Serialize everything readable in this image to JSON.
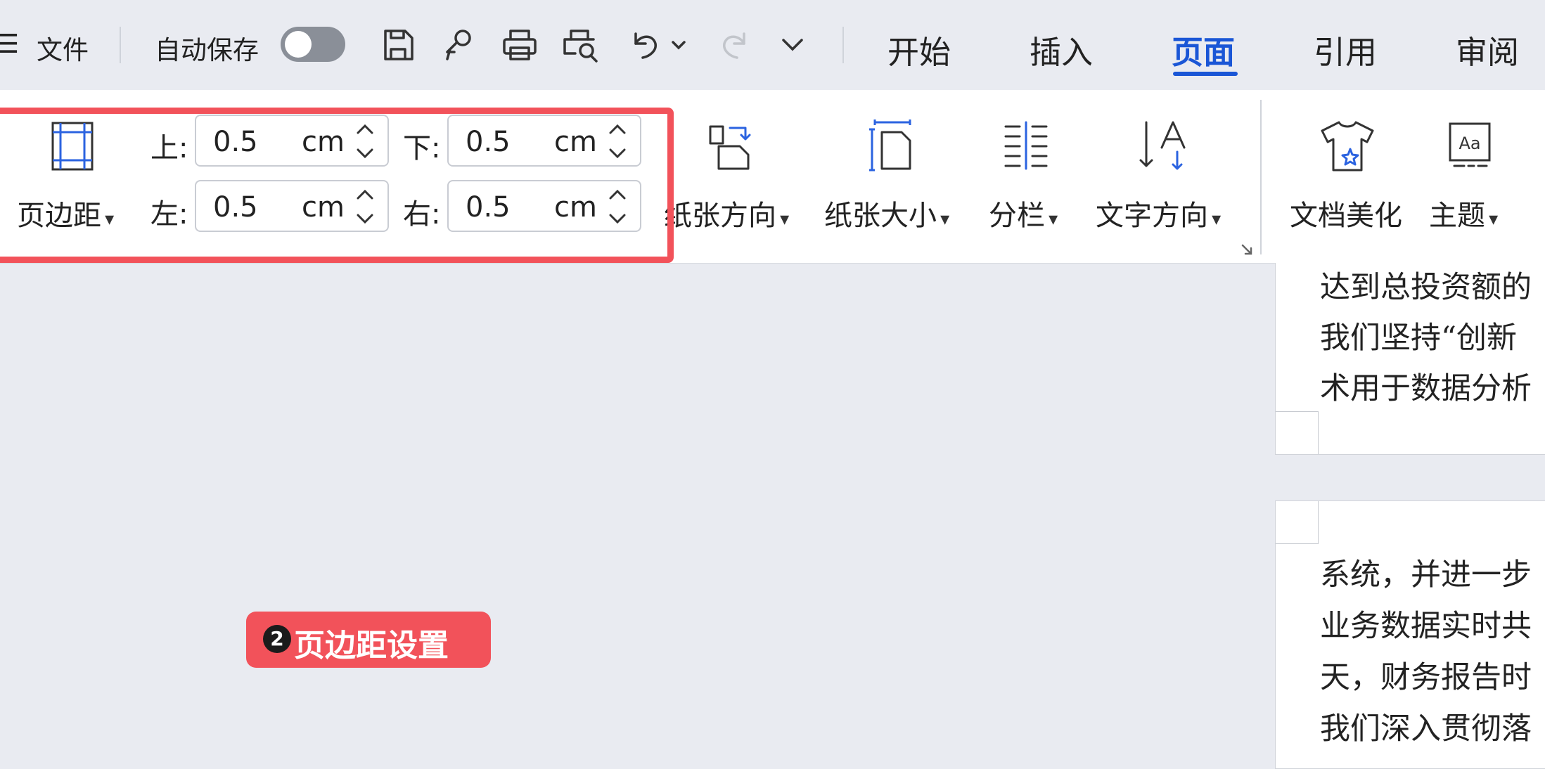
{
  "topbar": {
    "menu_glyph": "☰",
    "file_label": "文件",
    "autosave_label": "自动保存",
    "autosave_on": false,
    "icons": [
      "save-icon",
      "format-painter-icon",
      "print-icon",
      "print-preview-icon",
      "undo-icon",
      "redo-icon",
      "more-chevron-icon"
    ],
    "tabs": [
      {
        "label": "开始",
        "active": false
      },
      {
        "label": "插入",
        "active": false
      },
      {
        "label": "页面",
        "active": true
      },
      {
        "label": "引用",
        "active": false
      },
      {
        "label": "审阅",
        "active": false
      }
    ],
    "accent_color": "#1a56d6"
  },
  "ribbon": {
    "margins_label": "页边距",
    "top_label": "上:",
    "bottom_label": "下:",
    "left_label": "左:",
    "right_label": "右:",
    "top_value": "0.5",
    "bottom_value": "0.5",
    "left_value": "0.5",
    "right_value": "0.5",
    "unit": "cm",
    "orientation_label": "纸张方向",
    "size_label": "纸张大小",
    "columns_label": "分栏",
    "text_direction_label": "文字方向",
    "beautify_label": "文档美化",
    "theme_label": "主题",
    "theme_icon_text": "Aa",
    "highlight_color": "#f2525a"
  },
  "document": {
    "page1_lines": [
      "达到总投资额的",
      "我们坚持“创新",
      "术用于数据分析"
    ],
    "page2_lines": [
      "系统，并进一步",
      "业务数据实时共",
      "天，财务报告时",
      "我们深入贯彻落"
    ]
  },
  "annotation": {
    "number": "2",
    "text": "页边距设置"
  }
}
